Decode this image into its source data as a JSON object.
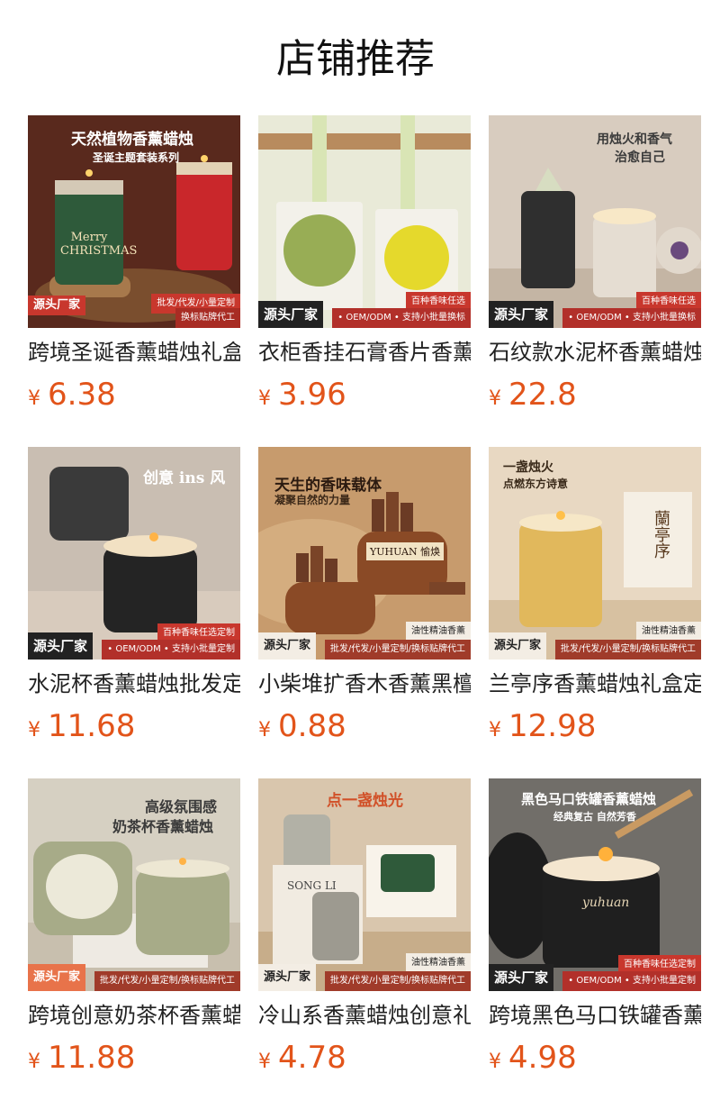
{
  "header": {
    "title": "店铺推荐"
  },
  "products": [
    {
      "title": "跨境圣诞香薰蜡烛礼盒",
      "currency": "¥",
      "price": "6.38",
      "thumb": {
        "headline": "天然植物香薰蜡烛",
        "sub": "圣诞主题套装系列",
        "badge_left": "源头厂家",
        "badge_right": "批发/代发/小量定制",
        "extra": "换标贴牌代工",
        "jar_text": "Merry CHRISTMAS"
      }
    },
    {
      "title": "衣柜香挂石膏香片香薰",
      "currency": "¥",
      "price": "3.96",
      "thumb": {
        "badge_left": "源头厂家",
        "badge_right": "百种香味任选",
        "extra": "• OEM/ODM • 支持小批量换标"
      }
    },
    {
      "title": "石纹款水泥杯香薰蜡烛",
      "currency": "¥",
      "price": "22.8",
      "thumb": {
        "headline": "用烛火和香气",
        "sub": "治愈自己",
        "badge_left": "源头厂家",
        "badge_right": "百种香味任选",
        "extra": "• OEM/ODM • 支持小批量换标"
      }
    },
    {
      "title": "水泥杯香薰蜡烛批发定制",
      "currency": "¥",
      "price": "11.68",
      "thumb": {
        "headline": "创意 ins 风",
        "badge_left": "源头厂家",
        "badge_right": "百种香味任选定制",
        "extra": "• OEM/ODM • 支持小批量定制"
      }
    },
    {
      "title": "小柴堆扩香木香薰黑檀",
      "currency": "¥",
      "price": "0.88",
      "thumb": {
        "headline": "天生的香味载体",
        "sub": "凝聚自然的力量",
        "badge_left": "源头厂家",
        "badge_right": "油性精油香薰",
        "extra": "批发/代发/小量定制/换标贴牌代工",
        "brand": "YUHUAN 愉焕"
      }
    },
    {
      "title": "兰亭序香薰蜡烛礼盒定制",
      "currency": "¥",
      "price": "12.98",
      "thumb": {
        "headline": "一盏烛火",
        "sub": "点燃东方诗意",
        "badge_left": "源头厂家",
        "badge_right": "油性精油香薰",
        "extra": "批发/代发/小量定制/换标贴牌代工",
        "box_text": "蘭亭序"
      }
    },
    {
      "title": "跨境创意奶茶杯香薰蜡烛",
      "currency": "¥",
      "price": "11.88",
      "thumb": {
        "headline": "高级氛围感",
        "sub": "奶茶杯香薰蜡烛",
        "badge_left": "源头厂家",
        "extra": "批发/代发/小量定制/换标贴牌代工"
      }
    },
    {
      "title": "冷山系香薰蜡烛创意礼盒",
      "currency": "¥",
      "price": "4.78",
      "thumb": {
        "headline": "点一盏烛光",
        "badge_left": "源头厂家",
        "badge_right": "油性精油香薰",
        "extra": "批发/代发/小量定制/换标贴牌代工",
        "box_text": "SONG LI"
      }
    },
    {
      "title": "跨境黑色马口铁罐香薰蜡烛",
      "currency": "¥",
      "price": "4.98",
      "thumb": {
        "headline": "黑色马口铁罐香薰蜡烛",
        "sub": "经典复古 自然芳香",
        "badge_left": "源头厂家",
        "badge_right": "百种香味任选定制",
        "extra": "• OEM/ODM • 支持小批量定制",
        "jar_text": "yuhuan"
      }
    }
  ],
  "colors": {
    "price": "#e2541a",
    "badge_red": "#c8372d",
    "badge_dark": "#222222"
  }
}
